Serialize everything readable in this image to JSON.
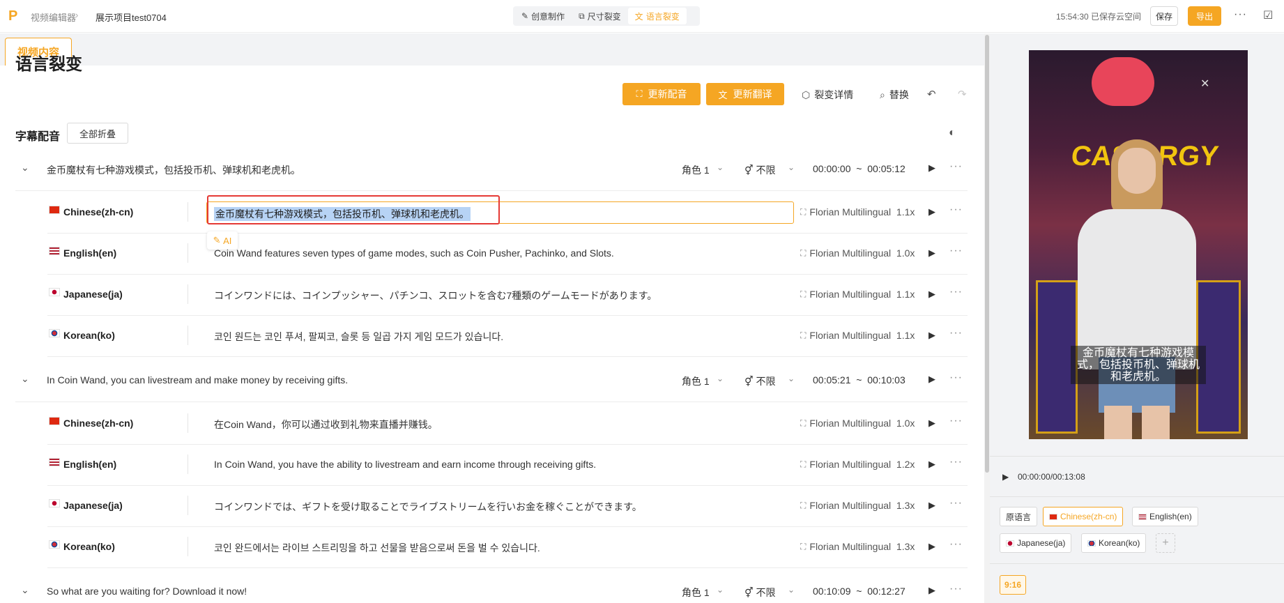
{
  "topbar": {
    "breadcrumb_root": "视频编辑器",
    "breadcrumb_sep": "›",
    "project_name": "展示项目test0704",
    "modes": [
      {
        "label": "创意制作",
        "icon": "magic-wand-icon"
      },
      {
        "label": "尺寸裂变",
        "icon": "resize-icon"
      },
      {
        "label": "语言裂变",
        "icon": "translate-icon"
      }
    ],
    "active_mode": "语言裂变",
    "saved_status": "15:54:30 已保存云空间",
    "save_label": "保存",
    "export_label": "导出",
    "more_label": "···"
  },
  "left": {
    "tab_label": "视频内容",
    "page_title": "语言裂变",
    "update_voice_label": "更新配音",
    "update_translation_label": "更新翻译",
    "detail_label": "裂变详情",
    "replace_label": "替换",
    "section_title": "字幕配音",
    "collapse_all_label": "全部折叠"
  },
  "segments": [
    {
      "text": "金币魔杖有七种游戏模式，包括投币机、弹球机和老虎机。",
      "role": "角色 1",
      "gender": "不限",
      "time": "00:00:00  ~  00:05:12",
      "langs": [
        {
          "name": "Chinese(zh-cn)",
          "text": "金币魔杖有七种游戏模式，包括投币机、弹球机和老虎机。",
          "voice": "Florian Multilingual",
          "speed": "1.1x"
        },
        {
          "name": "English(en)",
          "text": "Coin Wand features seven types of game modes, such as Coin Pusher, Pachinko, and Slots.",
          "voice": "Florian Multilingual",
          "speed": "1.0x"
        },
        {
          "name": "Japanese(ja)",
          "text": "コインワンドには、コインプッシャー、パチンコ、スロットを含む7種類のゲームモードがあります。",
          "voice": "Florian Multilingual",
          "speed": "1.1x"
        },
        {
          "name": "Korean(ko)",
          "text": "코인 원드는 코인 푸셔, 팔찌코, 슬롯 등 일곱 가지 게임 모드가 있습니다.",
          "voice": "Florian Multilingual",
          "speed": "1.1x"
        }
      ]
    },
    {
      "text": "In Coin Wand, you can livestream and make money by receiving gifts.",
      "role": "角色 1",
      "gender": "不限",
      "time": "00:05:21  ~  00:10:03",
      "langs": [
        {
          "name": "Chinese(zh-cn)",
          "text": "在Coin Wand，你可以通过收到礼物来直播并赚钱。",
          "voice": "Florian Multilingual",
          "speed": "1.0x"
        },
        {
          "name": "English(en)",
          "text": "In Coin Wand, you have the ability to livestream and earn income through receiving gifts.",
          "voice": "Florian Multilingual",
          "speed": "1.2x"
        },
        {
          "name": "Japanese(ja)",
          "text": "コインワンドでは、ギフトを受け取ることでライブストリームを行いお金を稼ぐことができます。",
          "voice": "Florian Multilingual",
          "speed": "1.3x"
        },
        {
          "name": "Korean(ko)",
          "text": "코인 완드에서는 라이브 스트리밍을 하고 선물을 받음으로써 돈을 벌 수 있습니다.",
          "voice": "Florian Multilingual",
          "speed": "1.3x"
        }
      ]
    },
    {
      "text": "So what are you waiting for? Download it now!",
      "role": "角色 1",
      "gender": "不限",
      "time": "00:10:09  ~  00:12:27"
    }
  ],
  "editing": {
    "ai_label": "AI"
  },
  "preview": {
    "sign_text": "CASH RGY",
    "caption": "金币魔杖有七种游戏模式，包括投币机、弹球机和老虎机。",
    "time": "00:00:00/00:13:08",
    "lang_chips": [
      {
        "label": "原语言",
        "flag": ""
      },
      {
        "label": "Chinese(zh-cn)",
        "flag": "cn"
      },
      {
        "label": "English(en)",
        "flag": "us"
      },
      {
        "label": "Japanese(ja)",
        "flag": "jp"
      },
      {
        "label": "Korean(ko)",
        "flag": "kr"
      }
    ],
    "active_lang": "Chinese(zh-cn)",
    "add_label": "+",
    "ratio": "9:16"
  },
  "colors": {
    "accent": "#f5a623",
    "highlight_border": "#e53935",
    "selection": "#b7d3f5"
  }
}
